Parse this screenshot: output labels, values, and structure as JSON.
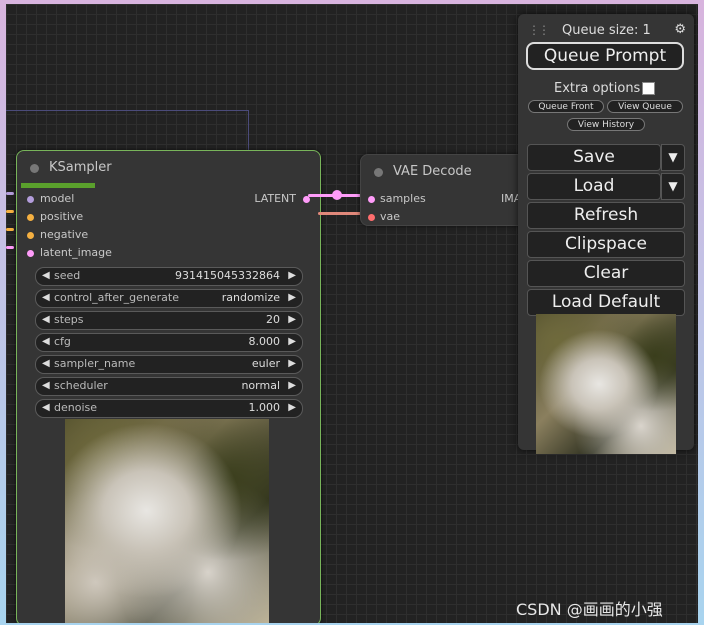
{
  "ksampler": {
    "title": "KSampler",
    "inputs": [
      {
        "label": "model",
        "color": "#b39ddb"
      },
      {
        "label": "positive",
        "color": "#f5b041"
      },
      {
        "label": "negative",
        "color": "#f5b041"
      },
      {
        "label": "latent_image",
        "color": "#ff9cf9"
      }
    ],
    "output": "LATENT",
    "widgets": [
      {
        "label": "seed",
        "value": "931415045332864"
      },
      {
        "label": "control_after_generate",
        "value": "randomize"
      },
      {
        "label": "steps",
        "value": "20"
      },
      {
        "label": "cfg",
        "value": "8.000"
      },
      {
        "label": "sampler_name",
        "value": "euler"
      },
      {
        "label": "scheduler",
        "value": "normal"
      },
      {
        "label": "denoise",
        "value": "1.000"
      }
    ]
  },
  "vae_decode": {
    "title": "VAE Decode",
    "inputs": [
      {
        "label": "samples",
        "color": "#ff9cf9"
      },
      {
        "label": "vae",
        "color": "#ff6e6e"
      }
    ],
    "output": "IMA"
  },
  "menu": {
    "queue_size": "Queue size: 1",
    "queue_prompt": "Queue Prompt",
    "extra_options": "Extra options",
    "queue_front": "Queue Front",
    "view_queue": "View Queue",
    "view_history": "View History",
    "save": "Save",
    "load": "Load",
    "refresh": "Refresh",
    "clipspace": "Clipspace",
    "clear": "Clear",
    "load_default": "Load Default"
  },
  "watermark": "CSDN @画画的小强",
  "colors": {
    "node_selected_border": "#78b45a",
    "progress": "#5aa02c",
    "latent_link": "#ff9cf9",
    "vae_link": "#ff6e6e"
  }
}
